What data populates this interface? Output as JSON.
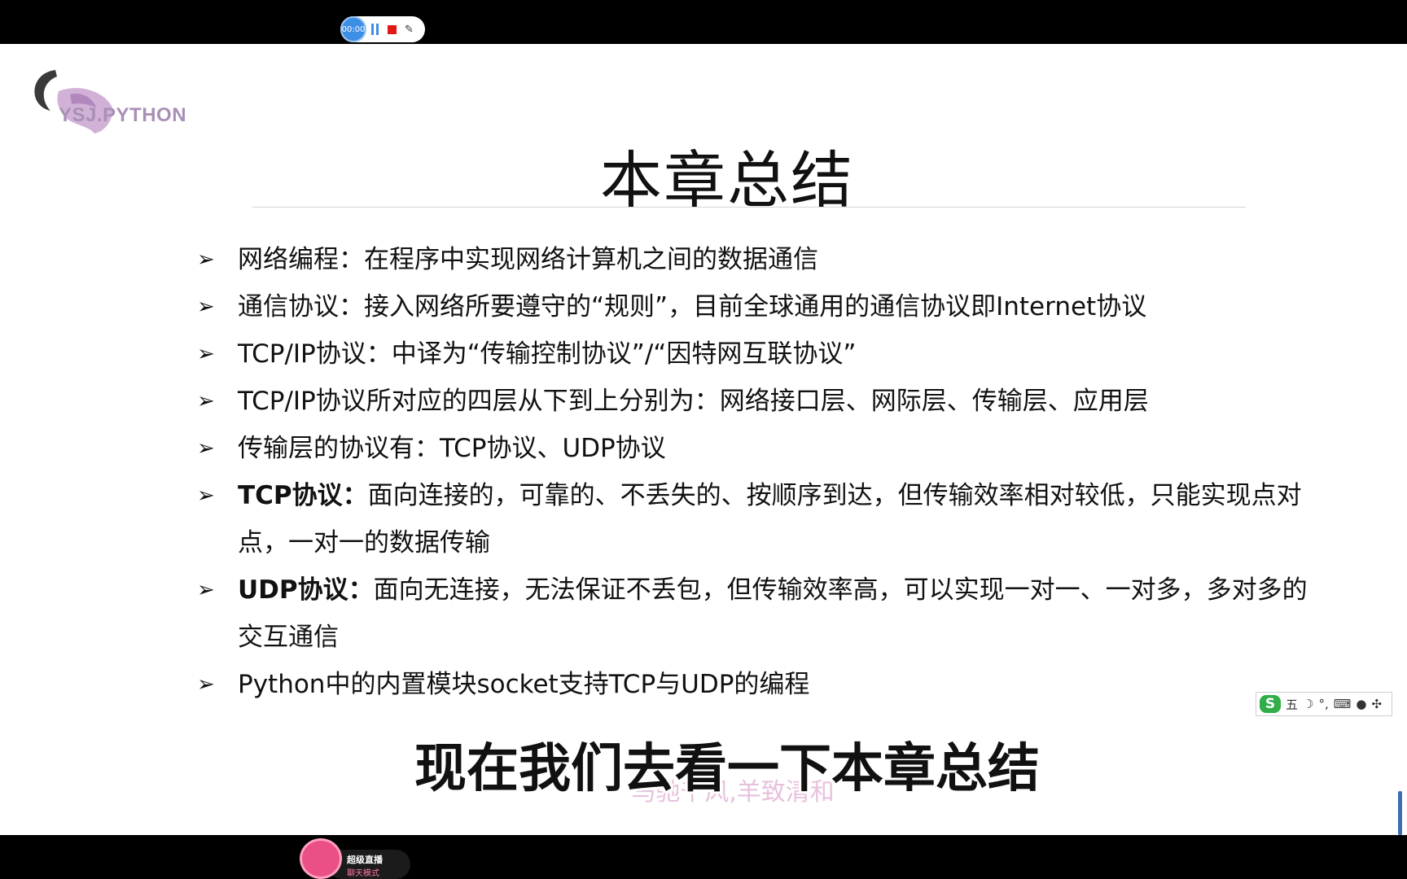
{
  "recorder": {
    "timer": "00:00"
  },
  "logo": {
    "text": "YSJ.PYTHON"
  },
  "slide": {
    "title": "本章总结",
    "bullets": [
      {
        "bold": "",
        "text": "网络编程：在程序中实现网络计算机之间的数据通信"
      },
      {
        "bold": "",
        "text": "通信协议：接入网络所要遵守的“规则”，目前全球通用的通信协议即Internet协议"
      },
      {
        "bold": "",
        "text": "TCP/IP协议：中译为“传输控制协议”/“因特网互联协议”"
      },
      {
        "bold": "",
        "text": "TCP/IP协议所对应的四层从下到上分别为：网络接口层、网际层、传输层、应用层"
      },
      {
        "bold": "",
        "text": "传输层的协议有：TCP协议、UDP协议"
      },
      {
        "bold": "TCP协议：",
        "text": "面向连接的，可靠的、不丢失的、按顺序到达，但传输效率相对较低，只能实现点对点，一对一的数据传输"
      },
      {
        "bold": "UDP协议：",
        "text": "面向无连接，无法保证不丢包，但传输效率高，可以实现一对一、一对多，多对多的交互通信"
      },
      {
        "bold": "",
        "text": "Python中的内置模块socket支持TCP与UDP的编程"
      }
    ]
  },
  "ime": {
    "logo": "S",
    "mode": "五",
    "punct": "°,",
    "icons": [
      "moon-icon",
      "keyboard-icon",
      "user-icon",
      "grid-icon"
    ]
  },
  "caption": {
    "subtitle": "现在我们去看一下本章总结",
    "watermark": "马驰千风,羊致清和"
  },
  "room": {
    "name": "超级直播",
    "mode": "聊天模式"
  },
  "colors": {
    "title": "#111111",
    "logo": "#a98fb6",
    "watermark": "#e3b7d8",
    "recorder": "#3d8fe6"
  }
}
